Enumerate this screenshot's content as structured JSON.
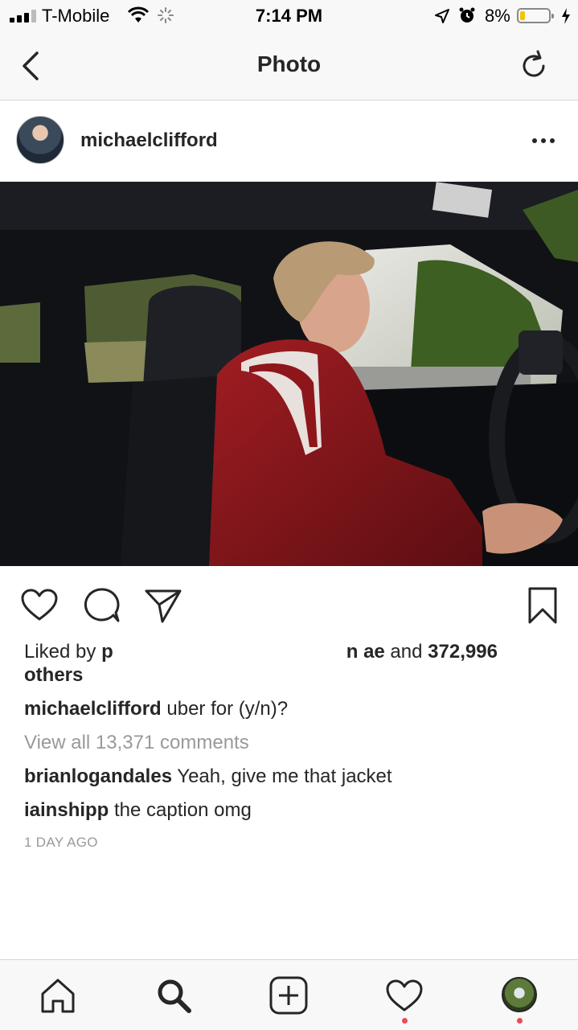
{
  "status_bar": {
    "carrier": "T-Mobile",
    "time": "7:14 PM",
    "battery_percent": "8%",
    "battery_level": 0.08,
    "icons": [
      "signal-icon",
      "wifi-icon",
      "activity-spinner-icon",
      "location-arrow-icon",
      "alarm-icon",
      "battery-icon",
      "charging-bolt-icon"
    ]
  },
  "nav": {
    "title": "Photo",
    "back_icon": "chevron-left-icon",
    "refresh_icon": "refresh-icon"
  },
  "post": {
    "username": "michaelclifford",
    "more_icon": "ellipsis-icon",
    "likes": {
      "prefix": "Liked by ",
      "first_user_partial": "p",
      "second_user_partial": "n ae",
      "and_text": " and ",
      "count": "372,996",
      "others": "others"
    },
    "caption": {
      "username": "michaelclifford",
      "text": " uber for (y/n)?"
    },
    "view_all": "View all 13,371 comments",
    "comments": [
      {
        "username": "brianlogandales",
        "text": " Yeah, give me that jacket"
      },
      {
        "username": "iainshipp",
        "text": " the caption omg"
      }
    ],
    "time_ago": "1 DAY AGO"
  },
  "actions": {
    "icons": [
      "heart-icon",
      "comment-icon",
      "share-icon",
      "bookmark-icon"
    ]
  },
  "tab_bar": {
    "icons": [
      "home-icon",
      "search-icon",
      "add-post-icon",
      "activity-heart-icon",
      "profile-icon"
    ],
    "notification_color": "#ed4956"
  },
  "colors": {
    "text": "#262626",
    "muted": "#999999",
    "bar_background": "#f8f8f8",
    "battery_fill": "#f5c400"
  }
}
